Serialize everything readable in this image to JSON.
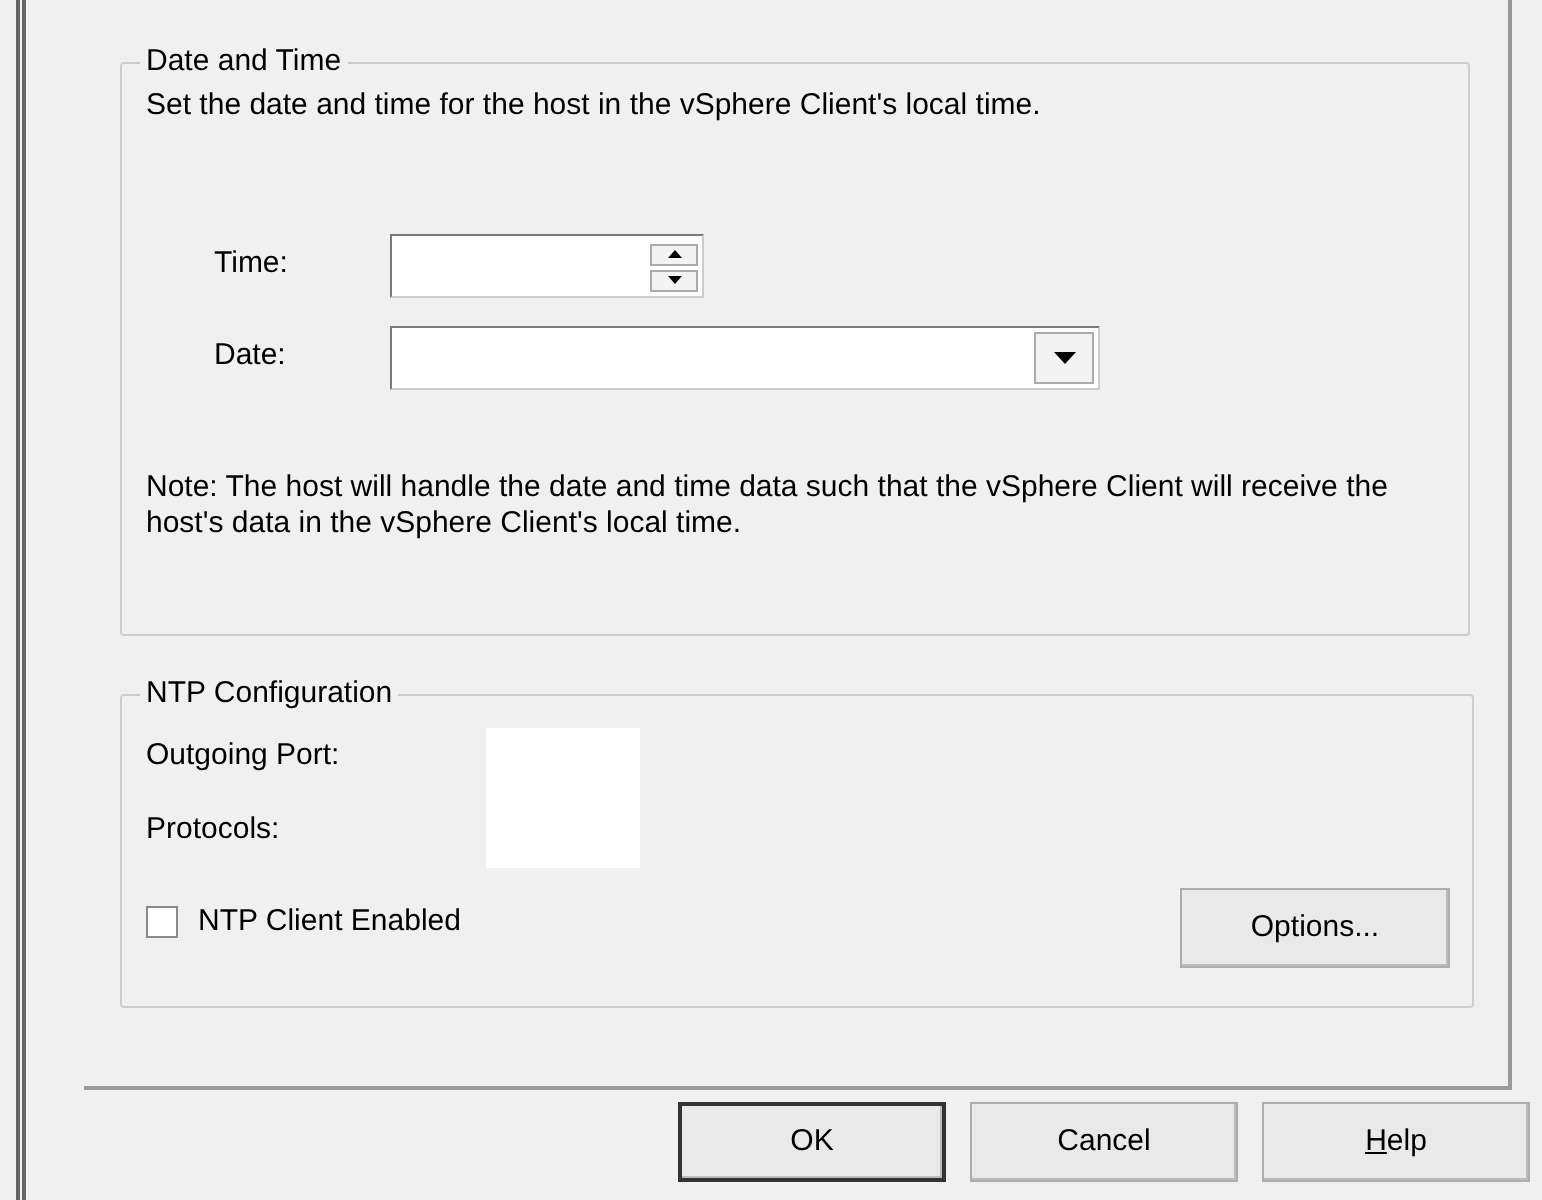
{
  "date_time": {
    "title": "Date and Time",
    "description": "Set the date and time for the host in the vSphere Client's local time.",
    "fields": [
      {
        "label": "Time:",
        "kind": "spinner"
      },
      {
        "label": "Date:",
        "kind": "dropdown"
      }
    ],
    "note": "Note: The host will handle the date and time data such that the vSphere Client will receive the host's data in the vSphere Client's local time."
  },
  "ntp": {
    "title": "NTP Configuration",
    "rows": [
      {
        "label": "Outgoing Port:"
      },
      {
        "label": "Protocols:"
      }
    ],
    "client_enabled": {
      "label": "NTP Client Enabled",
      "checked": false
    },
    "options_button": "Options..."
  },
  "buttons": [
    {
      "label": "OK",
      "default": true,
      "access_key": false
    },
    {
      "label": "Cancel",
      "default": false,
      "access_key": false
    },
    {
      "label": "Help",
      "default": false,
      "access_key": true
    }
  ]
}
